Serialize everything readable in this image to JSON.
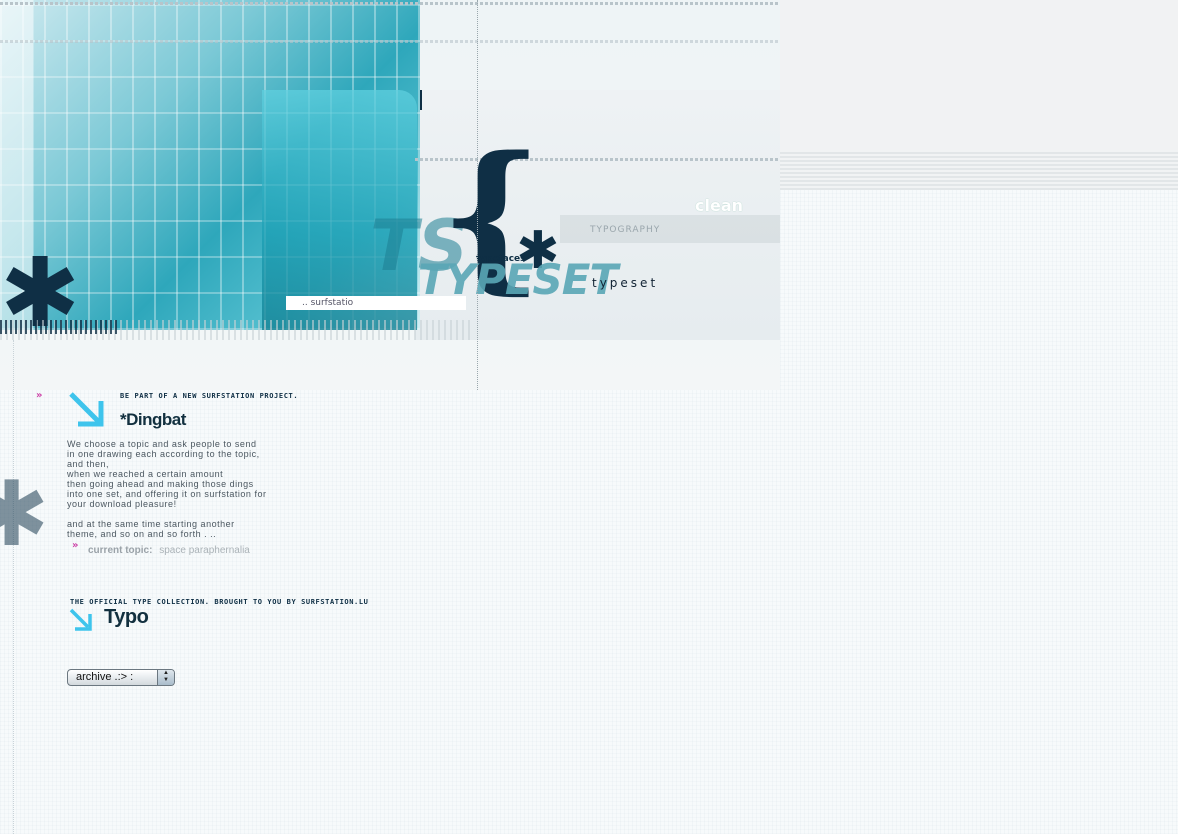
{
  "header": {
    "surfstation_tag": ".. surfstatio",
    "typefaces_label": "typefaces",
    "typeset_large": "TYPESET",
    "typeset_small": "typeset",
    "clean_label": "clean",
    "typography_label": "TYPOGRAPHY"
  },
  "dingbat": {
    "chevron": "»",
    "tagline": "BE PART OF A NEW SURFSTATION PROJECT.",
    "title": "*Dingbat",
    "paragraph1": "We choose a topic  and ask people to send in one drawing each according to the topic, and then,\nwhen we reached a certain amount\nthen going ahead and making those dings into one set,  and offering it on surfstation for your download pleasure!",
    "paragraph2": "and at the same time starting another theme, and so on  and so forth . ..",
    "current_topic_label": "current topic:",
    "current_topic_value": "space paraphernalia"
  },
  "typo": {
    "tagline": "THE OFFICIAL TYPE COLLECTION. BROUGHT TO YOU BY SURFSTATION.LU",
    "title": "Typo"
  },
  "archive": {
    "selected": "archive .:> :"
  },
  "colors": {
    "accent_cyan": "#3ec4ec",
    "chevron_pink": "#cc3fa6",
    "navy": "#0f2f45"
  },
  "icons": {
    "arrow": "arrow-down-right-icon",
    "star": "splat-star-icon"
  }
}
